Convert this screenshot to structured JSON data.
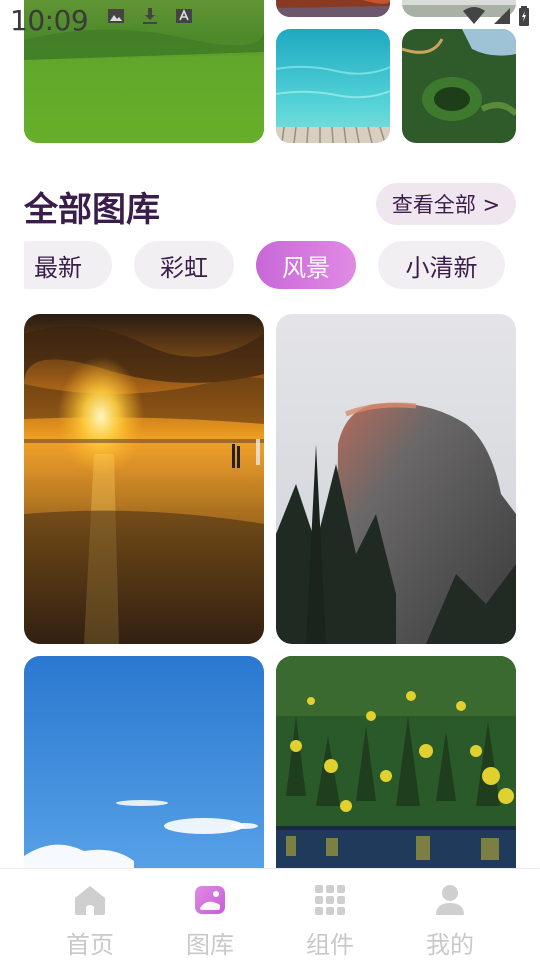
{
  "status_bar": {
    "time": "10:09",
    "left_icons": [
      "image-icon",
      "download-icon",
      "font-icon"
    ],
    "right_icons": [
      "wifi-icon",
      "signal-icon",
      "battery-icon"
    ]
  },
  "section": {
    "title": "全部图库",
    "view_all_label": "查看全部 >"
  },
  "tabs": [
    {
      "label": "最新",
      "active": false
    },
    {
      "label": "彩虹",
      "active": false
    },
    {
      "label": "风景",
      "active": true
    },
    {
      "label": "小清新",
      "active": false
    }
  ],
  "gallery": [
    {
      "scene": "sunset-beach"
    },
    {
      "scene": "granite-mountain"
    },
    {
      "scene": "blue-sky"
    },
    {
      "scene": "forest-lake"
    }
  ],
  "bottom_nav": [
    {
      "label": "首页",
      "icon": "home-icon",
      "active": false
    },
    {
      "label": "图库",
      "icon": "gallery-icon",
      "active": true
    },
    {
      "label": "组件",
      "icon": "grid-icon",
      "active": false
    },
    {
      "label": "我的",
      "icon": "user-icon",
      "active": false
    }
  ],
  "colors": {
    "accent": "#d47ade",
    "title": "#3a1d4a",
    "highlight": "#f7d84a",
    "nav_inactive": "#c9c9c9"
  }
}
